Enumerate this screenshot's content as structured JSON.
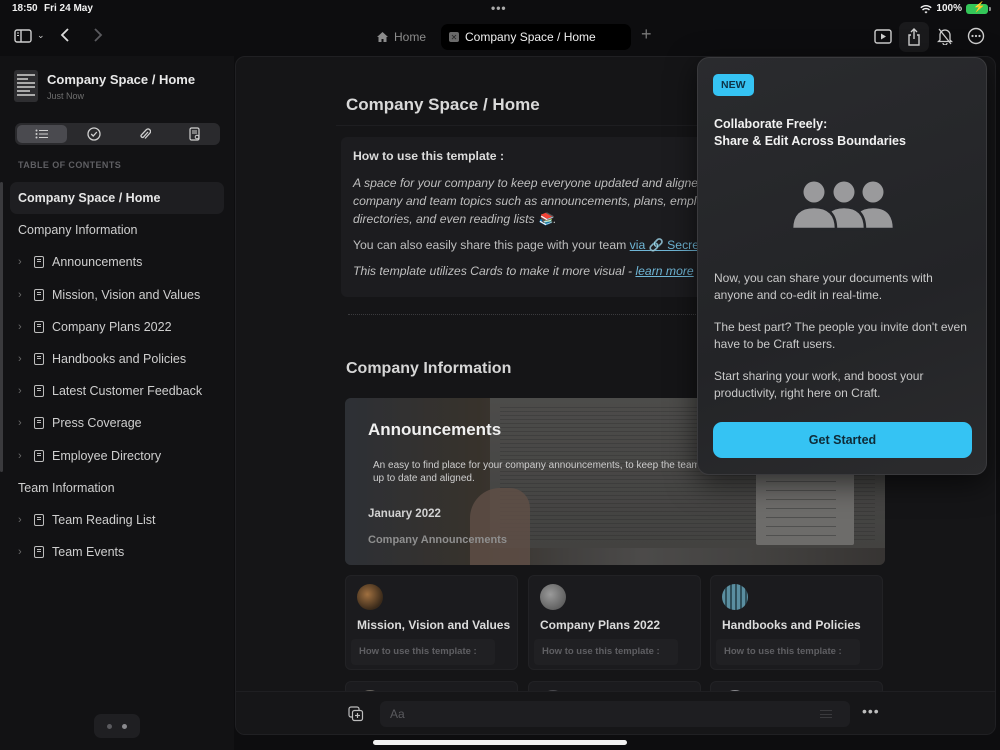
{
  "status_bar": {
    "time": "18:50",
    "date": "Fri 24 May",
    "battery": "100%"
  },
  "toolbar": {
    "tabs": [
      {
        "label": "Home",
        "icon": "house-icon",
        "active": false
      },
      {
        "label": "Company Space / Home",
        "icon": "close-icon",
        "active": true
      }
    ],
    "add_tab": "+",
    "right_icons": [
      "play-presentation-icon",
      "share-icon",
      "bell-slash-icon",
      "more-circle-icon"
    ]
  },
  "sidebar": {
    "doc_title": "Company Space / Home",
    "doc_subtitle": "Just Now",
    "segments": [
      "list-icon",
      "checkmark-circle-icon",
      "paperclip-icon",
      "document-search-icon"
    ],
    "toc_label": "TABLE OF CONTENTS",
    "toc": [
      {
        "label": "Company Space / Home",
        "level": 0,
        "selected": true
      },
      {
        "label": "Company Information",
        "level": 0
      },
      {
        "label": "Announcements",
        "level": 1
      },
      {
        "label": "Mission, Vision and Values",
        "level": 1
      },
      {
        "label": "Company Plans 2022",
        "level": 1
      },
      {
        "label": "Handbooks and Policies",
        "level": 1
      },
      {
        "label": "Latest Customer Feedback",
        "level": 1
      },
      {
        "label": "Press Coverage",
        "level": 1
      },
      {
        "label": "Employee Directory",
        "level": 1
      },
      {
        "label": "Team Information",
        "level": 0
      },
      {
        "label": "Team Reading List",
        "level": 1
      },
      {
        "label": "Team Events",
        "level": 1
      }
    ]
  },
  "document": {
    "title": "Company Space / Home",
    "howto": {
      "heading": "How to use this template :",
      "line1": "A space for your company to keep everyone updated and aligned",
      "line2": "company and team topics such as announcements, plans, employee",
      "line3": "directories, and even reading lists 📚.",
      "share_text": "You can also easily share this page with your team ",
      "share_link": "via 🔗 Secret Link",
      "cards_text": "This template utilizes Cards to make it more visual - ",
      "cards_link": "learn more"
    },
    "section_title": "Company Information",
    "announcements": {
      "title": "Announcements",
      "description": "An easy to find place for your company announcements, to keep the team up to date and aligned.",
      "month": "January 2022",
      "subheading": "Company Announcements"
    },
    "cards": [
      {
        "title": "Mission, Vision and Values",
        "preview": "How to use this template :"
      },
      {
        "title": "Company Plans 2022",
        "preview": "How to use this template :"
      },
      {
        "title": "Handbooks and Policies",
        "preview": "How to use this template :"
      }
    ],
    "bottom_bar": {
      "input_placeholder": "Aa",
      "more": "•••"
    }
  },
  "popover": {
    "badge": "NEW",
    "title_line1": "Collaborate Freely:",
    "title_line2": "Share & Edit Across Boundaries",
    "icon": "people-group-icon",
    "paragraphs": [
      "Now, you can share your documents with anyone and co-edit in real-time.",
      "The best part? The people you invite don't even have to be Craft users.",
      "Start sharing your work, and boost your productivity, right here on Craft."
    ],
    "cta": "Get Started",
    "accent_color": "#35c3f3"
  }
}
